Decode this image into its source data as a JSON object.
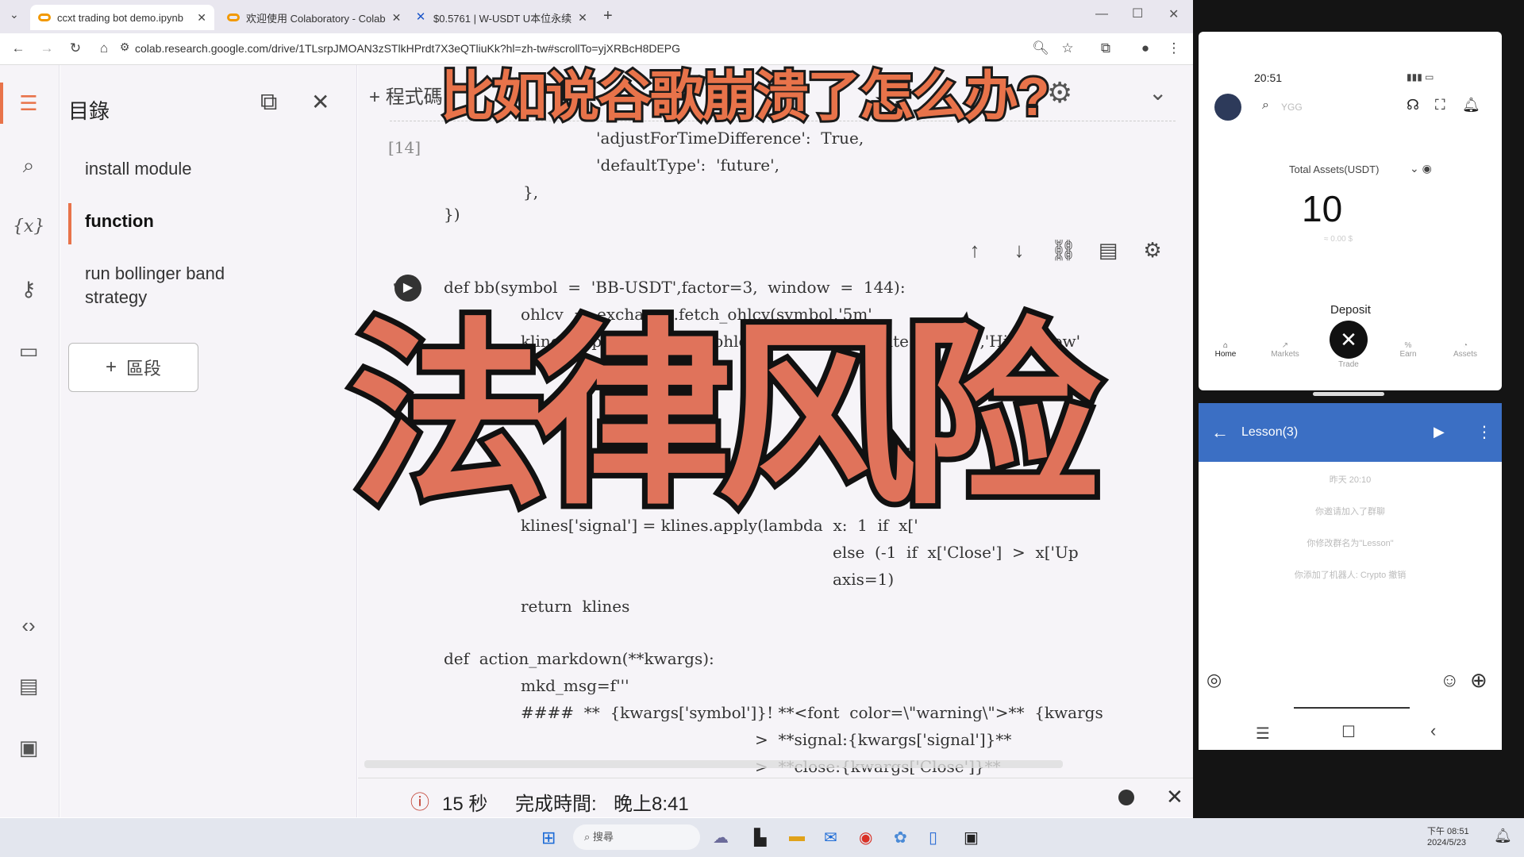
{
  "browser": {
    "tabs": [
      {
        "label": "ccxt trading bot demo.ipynb",
        "active": true
      },
      {
        "label": "欢迎使用 Colaboratory - Colab",
        "active": false
      },
      {
        "label": "$0.5761 | W-USDT U本位永续",
        "active": false
      }
    ],
    "new_tab_label": "+",
    "url": "colab.research.google.com/drive/1TLsrpJMOAN3zSTlkHPrdt7X3eQTliuKk?hl=zh-tw#scrollTo=yjXRBcH8DEPG"
  },
  "colab": {
    "toc": {
      "title": "目錄",
      "items": [
        "install module",
        "function",
        "run bollinger band strategy"
      ],
      "add_section_label": "區段"
    },
    "toolbar_label": "程式碼",
    "exec_count": "[14]",
    "code_lines": [
      "'adjustForTimeDifference':  True,",
      "'defaultType':  'future',",
      "},",
      "})",
      "def bb(symbol  =  'BB-USDT',factor=3,  window  =  144):",
      "ohlcv  =  exchange.fetch_ohlcv(symbol,'5m'",
      "klines = pd.DataFrame(ohlcv,columns  =  ['Date',  'Open','High','Low'",
      "klines['signal'] = klines.apply(lambda  x:  1  if  x['",
      "else  (-1  if  x['Close']  >  x['Up",
      "axis=1)",
      "return  klines",
      "def  action_markdown(**kwargs):",
      "mkd_msg=f'''",
      "####  **  {kwargs['symbol']}! **<font  color=\\\"warning\\\">**  {kwargs",
      ">  **signal:{kwargs['signal']}**",
      ">  **close:{kwargs['Close']}**"
    ],
    "status": {
      "duration": "15 秒",
      "completed_label": "完成時間:",
      "completed_time": "晚上8:41"
    }
  },
  "phone_app": {
    "time": "20:51",
    "search_placeholder": "YGG",
    "total_assets_label": "Total Assets(USDT)",
    "total_assets_value": "10",
    "total_assets_sub": "≈ 0.00 $",
    "deposit_label": "Deposit",
    "nav": [
      "Home",
      "Markets",
      "Trade",
      "Earn",
      "Assets"
    ]
  },
  "chat": {
    "title": "Lesson(3)",
    "timestamp": "昨天 20:10",
    "messages": [
      "你邀请加入了群聊",
      "你修改群名为\"Lesson\"",
      "你添加了机器人: Crypto 撤销"
    ]
  },
  "taskbar": {
    "search_placeholder": "搜尋",
    "clock_time": "下午 08:51",
    "clock_date": "2024/5/23"
  },
  "overlay": {
    "question": "比如说谷歌崩溃了怎么办?",
    "headline": "法律风险"
  },
  "colors": {
    "accent": "#e8734a",
    "chat_header": "#3b6fc4"
  }
}
